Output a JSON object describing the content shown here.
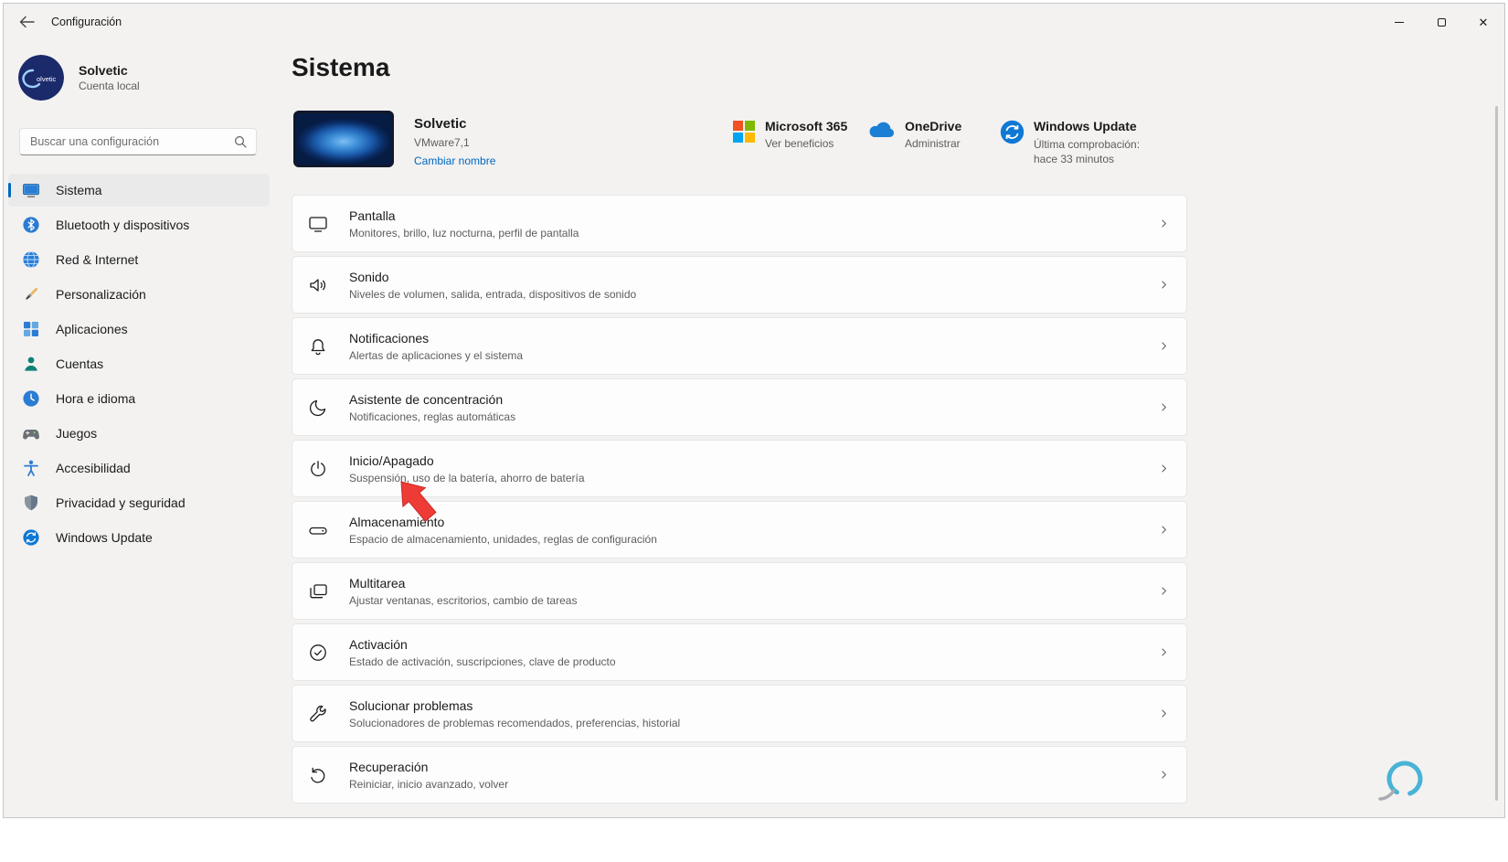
{
  "window": {
    "title": "Configuración"
  },
  "sidebar": {
    "user": {
      "name": "Solvetic",
      "account_type": "Cuenta local"
    },
    "search_placeholder": "Buscar una configuración",
    "items": [
      {
        "label": "Sistema",
        "icon": "system-icon",
        "selected": true
      },
      {
        "label": "Bluetooth y dispositivos",
        "icon": "bluetooth-icon"
      },
      {
        "label": "Red & Internet",
        "icon": "network-globe-icon"
      },
      {
        "label": "Personalización",
        "icon": "personalization-brush-icon"
      },
      {
        "label": "Aplicaciones",
        "icon": "apps-icon"
      },
      {
        "label": "Cuentas",
        "icon": "accounts-person-icon"
      },
      {
        "label": "Hora e idioma",
        "icon": "clock-icon"
      },
      {
        "label": "Juegos",
        "icon": "gamepad-icon"
      },
      {
        "label": "Accesibilidad",
        "icon": "accessibility-icon"
      },
      {
        "label": "Privacidad y seguridad",
        "icon": "shield-icon"
      },
      {
        "label": "Windows Update",
        "icon": "windows-update-icon"
      }
    ]
  },
  "main": {
    "page_title": "Sistema",
    "device": {
      "name": "Solvetic",
      "model": "VMware7,1",
      "rename_link": "Cambiar nombre"
    },
    "quick_links": [
      {
        "title": "Microsoft 365",
        "subtitle": "Ver beneficios",
        "icon": "microsoft-365-icon"
      },
      {
        "title": "OneDrive",
        "subtitle": "Administrar",
        "icon": "onedrive-cloud-icon"
      },
      {
        "title": "Windows Update",
        "subtitle": "Última comprobación: hace 33 minutos",
        "icon": "windows-update-badge-icon"
      }
    ],
    "settings": [
      {
        "title": "Pantalla",
        "subtitle": "Monitores, brillo, luz nocturna, perfil de pantalla",
        "icon": "display-icon"
      },
      {
        "title": "Sonido",
        "subtitle": "Niveles de volumen, salida, entrada, dispositivos de sonido",
        "icon": "sound-icon"
      },
      {
        "title": "Notificaciones",
        "subtitle": "Alertas de aplicaciones y el sistema",
        "icon": "bell-icon"
      },
      {
        "title": "Asistente de concentración",
        "subtitle": "Notificaciones, reglas automáticas",
        "icon": "moon-icon"
      },
      {
        "title": "Inicio/Apagado",
        "subtitle": "Suspensión, uso de la batería, ahorro de batería",
        "icon": "power-icon"
      },
      {
        "title": "Almacenamiento",
        "subtitle": "Espacio de almacenamiento, unidades, reglas de configuración",
        "icon": "storage-icon"
      },
      {
        "title": "Multitarea",
        "subtitle": "Ajustar ventanas, escritorios, cambio de tareas",
        "icon": "multitask-icon"
      },
      {
        "title": "Activación",
        "subtitle": "Estado de activación, suscripciones, clave de producto",
        "icon": "activation-check-icon"
      },
      {
        "title": "Solucionar problemas",
        "subtitle": "Solucionadores de problemas recomendados, preferencias, historial",
        "icon": "wrench-icon"
      },
      {
        "title": "Recuperación",
        "subtitle": "Reiniciar, inicio avanzado, volver",
        "icon": "recovery-icon"
      }
    ]
  },
  "colors": {
    "accent": "#0067c0",
    "annotation_arrow": "#ef3b36",
    "watermark_teal": "#49b3d6"
  }
}
